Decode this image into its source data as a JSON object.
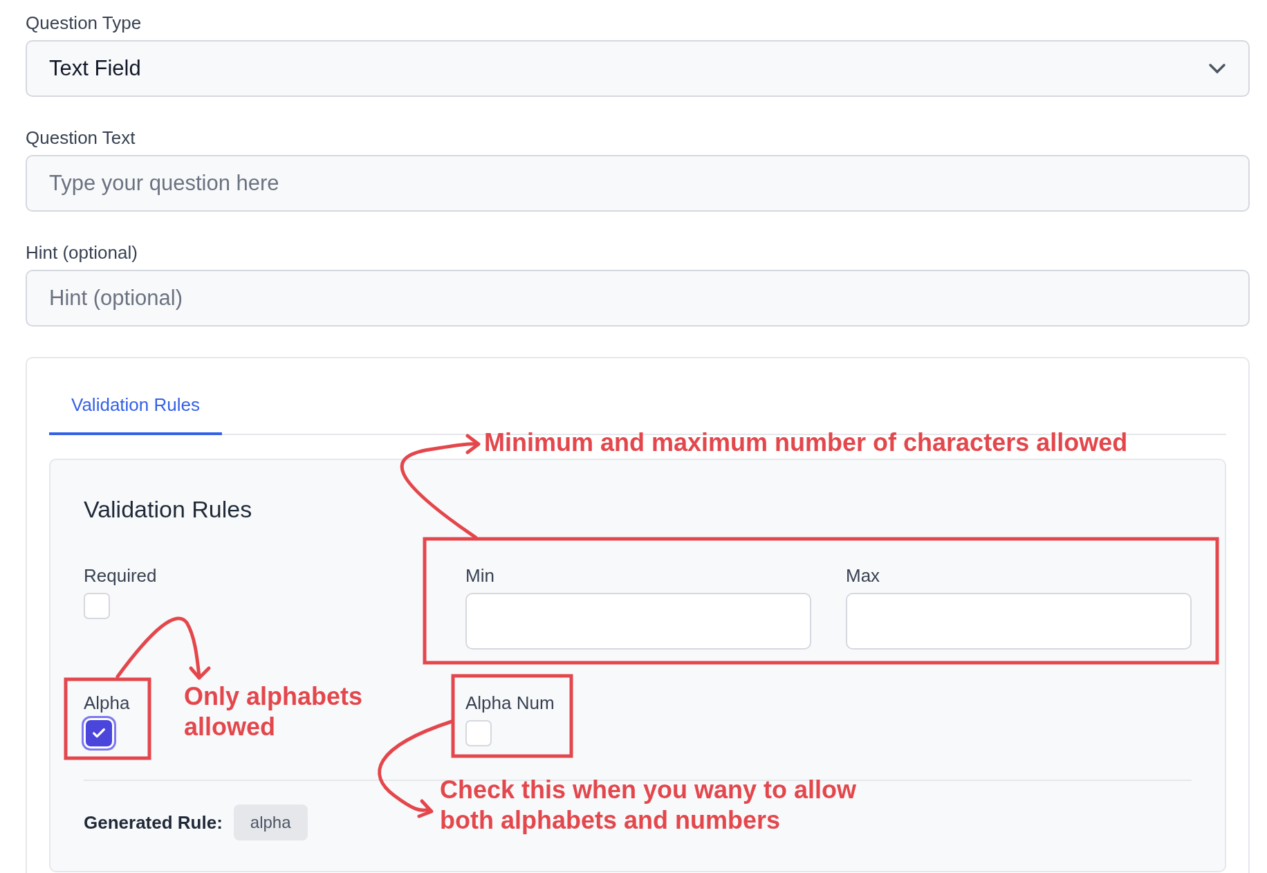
{
  "fields": [
    {
      "kind": "select",
      "label": "Question Type",
      "value": "Text Field"
    },
    {
      "kind": "text",
      "label": "Question Text",
      "placeholder": "Type your question here"
    },
    {
      "kind": "text",
      "label": "Hint (optional)",
      "placeholder": "Hint (optional)"
    }
  ],
  "tabs": [
    {
      "label": "Validation Rules",
      "selected": true
    }
  ],
  "panel": {
    "title": "Validation Rules",
    "rules": [
      {
        "kind": "checkbox",
        "label": "Required",
        "checked": false
      },
      {
        "kind": "range",
        "fields": [
          {
            "label": "Min"
          },
          {
            "label": "Max"
          }
        ]
      },
      {
        "kind": "checkbox",
        "label": "Alpha",
        "checked": true
      },
      {
        "kind": "checkbox",
        "label": "Alpha Num",
        "checked": false
      }
    ],
    "generated_rule": {
      "label": "Generated Rule:",
      "value": "alpha"
    }
  },
  "annotations": [
    {
      "text": "Minimum and maximum number of characters allowed"
    },
    {
      "text": "Only alphabets allowed"
    },
    {
      "text": "Check this when you wany to allow both alphabets and numbers"
    }
  ]
}
